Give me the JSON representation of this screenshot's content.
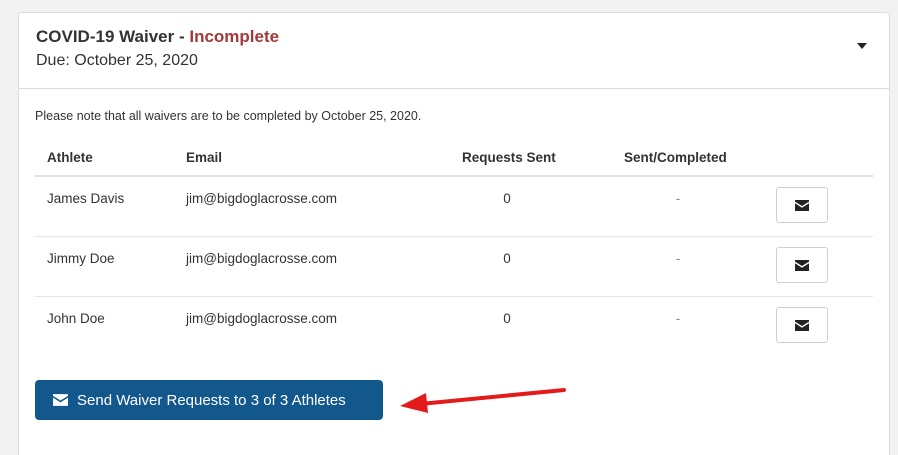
{
  "waiver": {
    "title": "COVID-19 Waiver",
    "separator": " - ",
    "status": "Incomplete",
    "due": "Due: October 25, 2020",
    "note": "Please note that all waivers are to be completed by October 25, 2020."
  },
  "table": {
    "headers": {
      "athlete": "Athlete",
      "email": "Email",
      "requests": "Requests Sent",
      "sent_completed": "Sent/Completed"
    },
    "rows": [
      {
        "athlete": "James Davis",
        "email": "jim@bigdoglacrosse.com",
        "requests": "0",
        "sent_completed": "-"
      },
      {
        "athlete": "Jimmy Doe",
        "email": "jim@bigdoglacrosse.com",
        "requests": "0",
        "sent_completed": "-"
      },
      {
        "athlete": "John Doe",
        "email": "jim@bigdoglacrosse.com",
        "requests": "0",
        "sent_completed": "-"
      }
    ]
  },
  "actions": {
    "send_all_label": "Send Waiver Requests to 3 of 3 Athletes"
  },
  "icons": {
    "envelope": "envelope-icon",
    "caret": "caret-down-icon",
    "annotation_arrow": "red-arrow"
  },
  "colors": {
    "status": "#a33a3a",
    "primary_button": "#13588d",
    "annotation": "#e31b1b"
  }
}
